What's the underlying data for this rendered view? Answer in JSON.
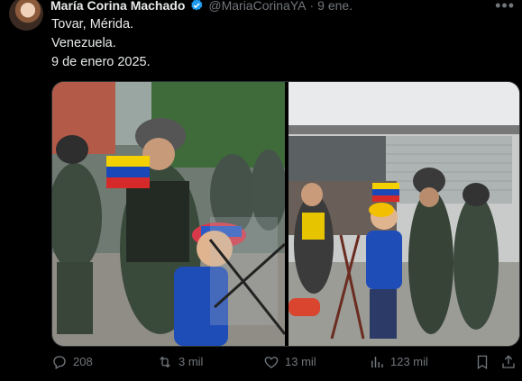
{
  "author": {
    "name": "María Corina Machado",
    "handle": "@MariaCorinaYA",
    "separator": "·",
    "date": "9 ene."
  },
  "post": {
    "lines": [
      "Tovar, Mérida.",
      "Venezuela.",
      "9 de enero 2025."
    ]
  },
  "media": {
    "alt": ""
  },
  "actions": {
    "replies": "208",
    "reposts": "3 mil",
    "likes": "13 mil",
    "views": "123 mil"
  },
  "icons": {
    "verified": "verified-badge-icon",
    "more": "more-options-icon",
    "reply": "reply-icon",
    "repost": "repost-icon",
    "like": "heart-icon",
    "views": "views-chart-icon",
    "bookmark": "bookmark-icon",
    "share": "share-icon"
  },
  "colors": {
    "background": "#000000",
    "text": "#e7e9ea",
    "muted": "#71767b",
    "verified": "#1d9bf0"
  }
}
